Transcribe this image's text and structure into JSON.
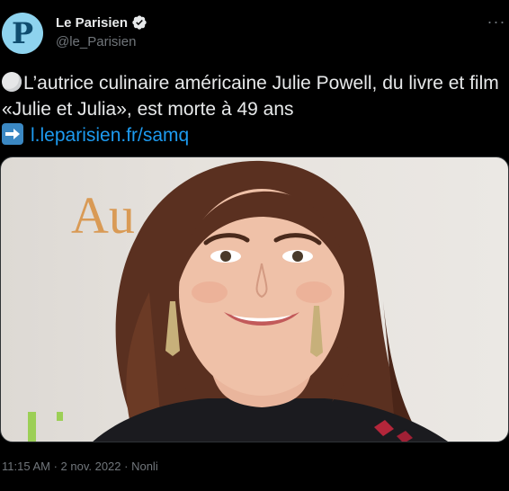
{
  "author": {
    "name": "Le Parisien",
    "handle": "@le_Parisien",
    "avatar_letter": "P",
    "verified_icon": "verified-badge-icon",
    "accent_color": "#1d9bf0"
  },
  "tweet": {
    "text_line": "L’autrice culinaire américaine Julie Powell, du livre et film «Julie et Julia», est morte à 49 ans",
    "link_text": "l.leparisien.fr/samq",
    "leading_emoji": "white-circle-emoji",
    "link_emoji": "right-arrow-emoji"
  },
  "photo": {
    "background_text": "Au"
  },
  "meta": {
    "time": "11:15 AM",
    "separator": " · ",
    "date": "2 nov. 2022",
    "source": "Nonli"
  },
  "menu": {
    "more_label": "···"
  }
}
